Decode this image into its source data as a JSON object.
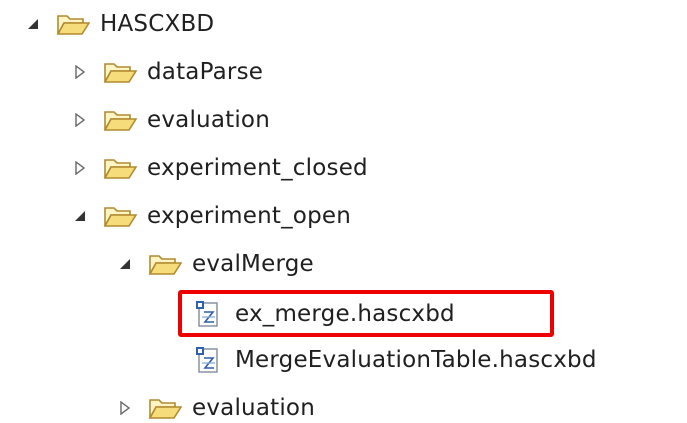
{
  "tree": {
    "items": [
      {
        "label": "HASCXBD",
        "type": "folder",
        "expanded": true
      },
      {
        "label": "dataParse",
        "type": "folder",
        "expanded": false
      },
      {
        "label": "evaluation",
        "type": "folder",
        "expanded": false
      },
      {
        "label": "experiment_closed",
        "type": "folder",
        "expanded": false
      },
      {
        "label": "experiment_open",
        "type": "folder",
        "expanded": true
      },
      {
        "label": "evalMerge",
        "type": "folder",
        "expanded": true
      },
      {
        "label": "ex_merge.hascxbd",
        "type": "file",
        "selected": true
      },
      {
        "label": "MergeEvaluationTable.hascxbd",
        "type": "file",
        "selected": false
      },
      {
        "label": "evaluation",
        "type": "folder",
        "expanded": false
      }
    ]
  },
  "colors": {
    "highlight": "#ee0000",
    "folder_fill": "#f6dc7a",
    "folder_stroke": "#b08a2e",
    "file_accent": "#2f5fae"
  },
  "icons": {
    "folder": "open-folder-icon",
    "file": "hascxbd-file-icon",
    "expanded": "expanded-triangle-icon",
    "collapsed": "collapsed-triangle-icon"
  }
}
